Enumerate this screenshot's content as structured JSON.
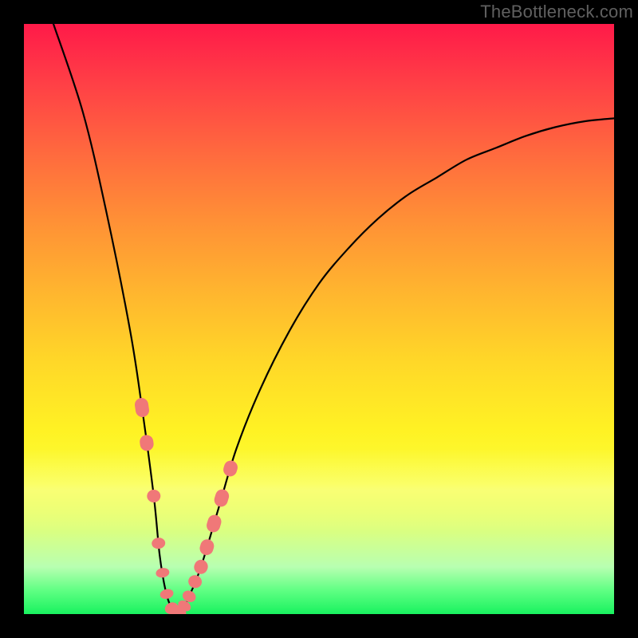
{
  "watermark": "TheBottleneck.com",
  "chart_data": {
    "type": "line",
    "title": "",
    "xlabel": "",
    "ylabel": "",
    "xlim": [
      0,
      100
    ],
    "ylim": [
      0,
      100
    ],
    "grid": false,
    "legend": false,
    "series": [
      {
        "name": "bottleneck-curve",
        "x": [
          5,
          10,
          14,
          18,
          20,
          22,
          23,
          24,
          25,
          26,
          27,
          28,
          30,
          33,
          36,
          40,
          45,
          50,
          55,
          60,
          65,
          70,
          75,
          80,
          85,
          90,
          95,
          100
        ],
        "values": [
          100,
          85,
          68,
          48,
          35,
          20,
          10,
          4,
          1,
          0,
          1,
          3,
          8,
          18,
          28,
          38,
          48,
          56,
          62,
          67,
          71,
          74,
          77,
          79,
          81,
          82.5,
          83.5,
          84
        ]
      }
    ],
    "markers": {
      "name": "highlighted-points",
      "points_on_curve_x": [
        20.0,
        20.8,
        22.0,
        22.8,
        23.5,
        24.2,
        25.0,
        25.8,
        26.5,
        27.2,
        28.0,
        29.0,
        30.0,
        31.0,
        32.2,
        33.5,
        35.0
      ],
      "color": "#f07878"
    }
  }
}
